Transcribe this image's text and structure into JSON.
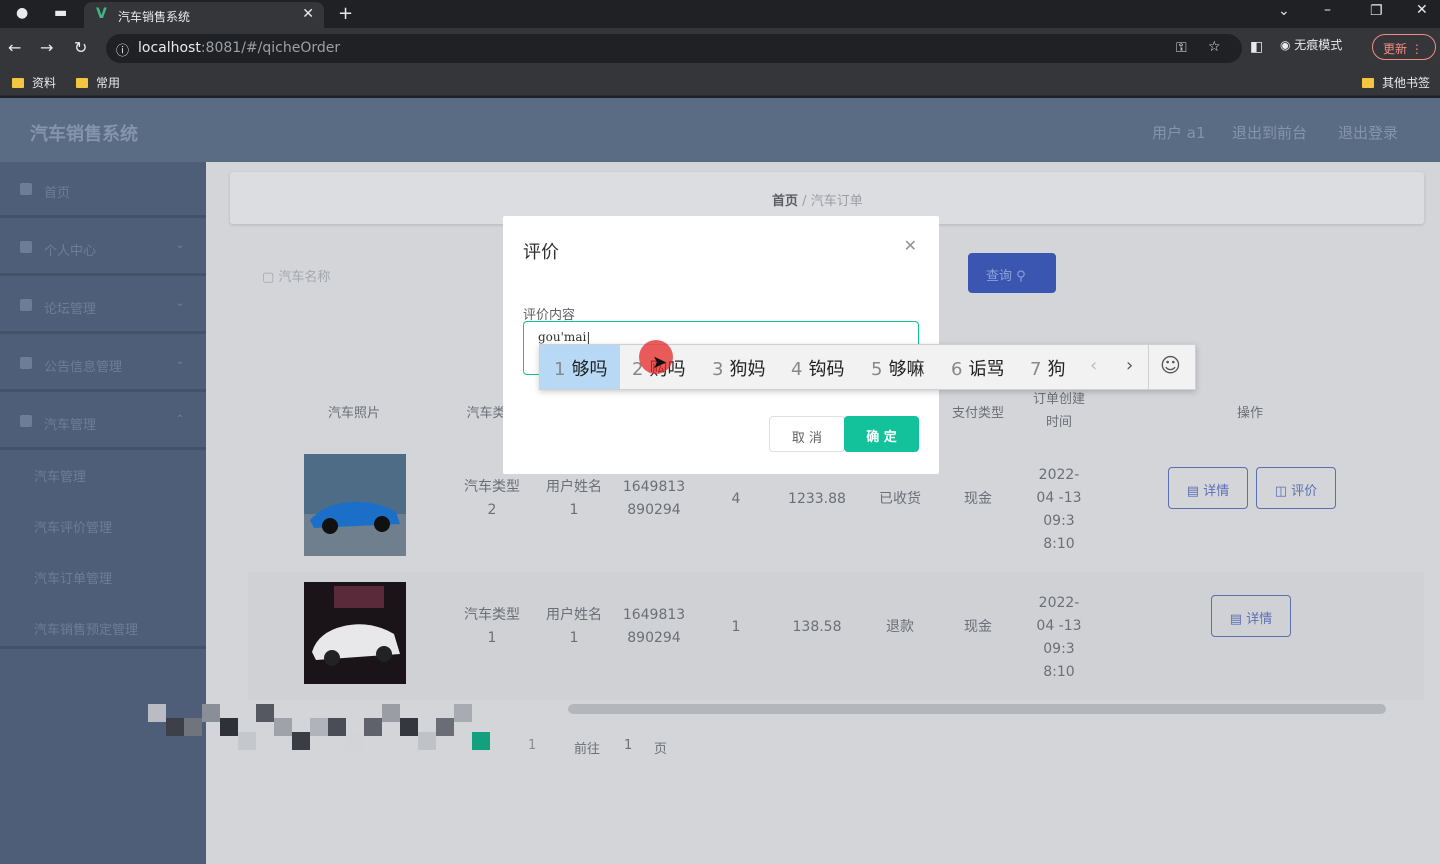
{
  "browser": {
    "tab_title": "汽车销售系统",
    "url_host": "localhost",
    "url_rest": ":8081/#/qicheOrder",
    "incognito_label": "无痕模式",
    "update_label": "更新",
    "bookmarks": [
      "资料",
      "常用"
    ],
    "other_bookmarks": "其他书签"
  },
  "app": {
    "brand": "汽车销售系统",
    "header_links": [
      "用户 a1",
      "退出到前台",
      "退出登录"
    ],
    "sidebar": {
      "items": [
        "首页",
        "个人中心",
        "论坛管理",
        "公告信息管理",
        "汽车管理"
      ],
      "subitems": [
        "汽车管理",
        "汽车评价管理",
        "汽车订单管理",
        "汽车销售预定管理"
      ]
    },
    "breadcrumb": {
      "home": "首页",
      "sep": "/",
      "current": "汽车订单"
    },
    "search_label": "汽车名称",
    "query_button": "查询",
    "table": {
      "headers": [
        "汽车照片",
        "汽车类",
        "支付类型",
        "订单创建时间",
        "操作"
      ],
      "rows": [
        {
          "car_type": "汽车类型 2",
          "user": "用户姓名 1",
          "order_no": "1649813 890294",
          "qty": "4",
          "price": "1233.88",
          "status": "已收货",
          "pay": "现金",
          "time": "2022-04 -13 09:3 8:10",
          "actions": [
            "详情",
            "评价"
          ]
        },
        {
          "car_type": "汽车类型 1",
          "user": "用户姓名 1",
          "order_no": "1649813 890294",
          "qty": "1",
          "price": "138.58",
          "status": "退款",
          "pay": "现金",
          "time": "2022-04 -13 09:3 8:10",
          "actions": [
            "详情"
          ]
        }
      ]
    },
    "pager": {
      "goto": "前往",
      "page": "1",
      "unit": "页",
      "current": "1"
    }
  },
  "modal": {
    "title": "评价",
    "field_label": "评价内容",
    "textarea_value": "gou'mai",
    "cancel": "取 消",
    "ok": "确 定"
  },
  "ime": {
    "candidates": [
      {
        "n": "1",
        "text": "够吗"
      },
      {
        "n": "2",
        "text": "购吗"
      },
      {
        "n": "3",
        "text": "狗妈"
      },
      {
        "n": "4",
        "text": "钩码"
      },
      {
        "n": "5",
        "text": "够嘛"
      },
      {
        "n": "6",
        "text": "诟骂"
      },
      {
        "n": "7",
        "text": "狗"
      }
    ],
    "prev": "‹",
    "next": "›",
    "emoji": "☺"
  },
  "colors": {
    "accent": "#13c29b",
    "primary": "#3b56b0",
    "header": "#5a6b84"
  }
}
